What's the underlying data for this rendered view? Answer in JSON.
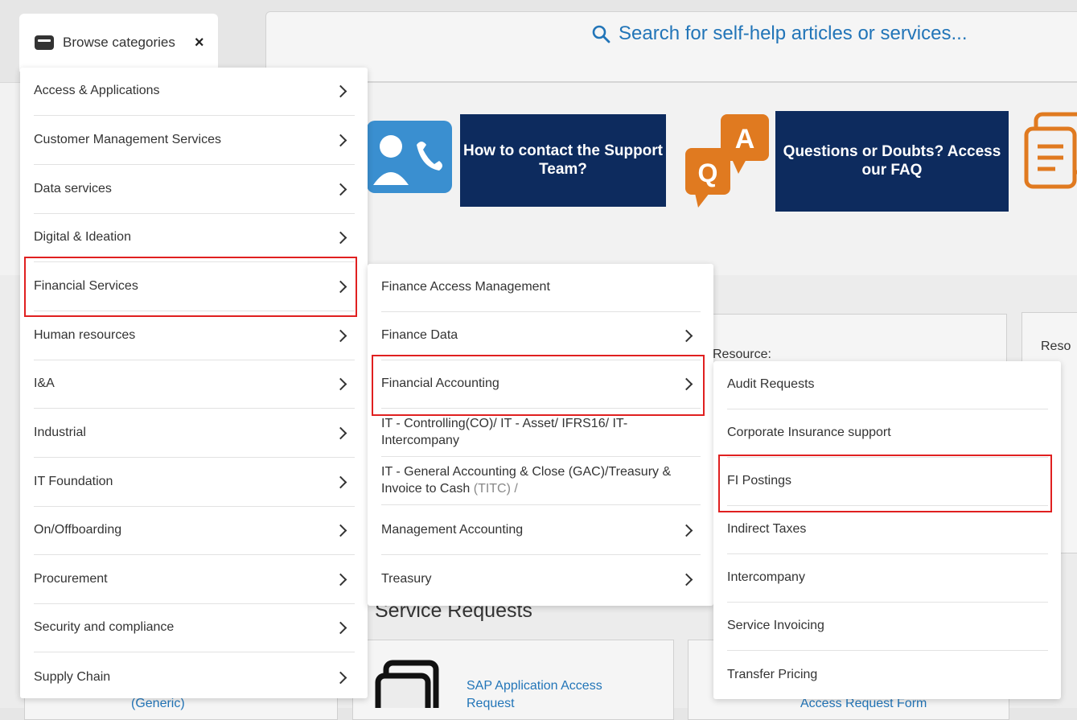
{
  "search": {
    "placeholder_text": "Search for self-help articles or services..."
  },
  "banners": {
    "contact": "How to contact the Support Team?",
    "faq": "Questions or Doubts? Access our FAQ"
  },
  "background": {
    "resource_label": "Resource:",
    "reso_label": "Reso",
    "service_requests_title": "Service Requests",
    "card1_link": "(Generic)",
    "card2_link": "SAP Application Access Request",
    "card3_link": "Access Request Form"
  },
  "browse": {
    "label": "Browse categories",
    "close": "×"
  },
  "menu1": {
    "items": [
      {
        "label": "Access & Applications"
      },
      {
        "label": "Customer Management Services"
      },
      {
        "label": "Data services"
      },
      {
        "label": "Digital & Ideation"
      },
      {
        "label": "Financial Services"
      },
      {
        "label": "Human resources"
      },
      {
        "label": "I&A"
      },
      {
        "label": "Industrial"
      },
      {
        "label": "IT Foundation"
      },
      {
        "label": "On/Offboarding"
      },
      {
        "label": "Procurement"
      },
      {
        "label": "Security and compliance"
      },
      {
        "label": "Supply Chain"
      }
    ]
  },
  "menu2": {
    "items": [
      {
        "label": "Finance Access Management"
      },
      {
        "label": "Finance Data"
      },
      {
        "label": "Financial Accounting"
      },
      {
        "label": "IT - Controlling(CO)/ IT - Asset/ IFRS16/ IT-Intercompany"
      },
      {
        "label": "IT - General Accounting & Close (GAC)/Treasury & Invoice to Cash",
        "muted": "(TITC) /"
      },
      {
        "label": "Management Accounting"
      },
      {
        "label": "Treasury"
      }
    ]
  },
  "menu3": {
    "items": [
      {
        "label": "Audit Requests"
      },
      {
        "label": "Corporate Insurance support"
      },
      {
        "label": "FI Postings"
      },
      {
        "label": "Indirect Taxes"
      },
      {
        "label": "Intercompany"
      },
      {
        "label": "Service Invoicing"
      },
      {
        "label": "Transfer Pricing"
      }
    ]
  },
  "colors": {
    "accent": "#2275b8",
    "banner": "#0d2b5e",
    "highlight": "#e02020",
    "icon_orange": "#e07a20",
    "icon_blue": "#3a8fd0"
  }
}
